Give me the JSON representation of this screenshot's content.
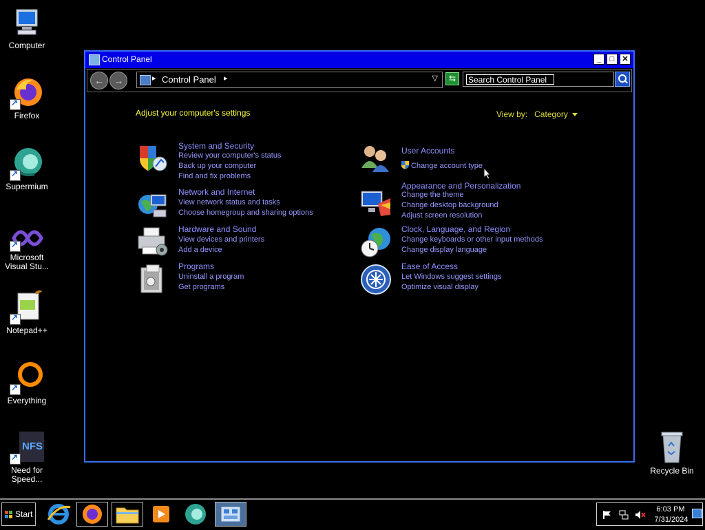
{
  "desktop": {
    "icons": [
      {
        "label": "Computer"
      },
      {
        "label": "Firefox"
      },
      {
        "label": "Supermium"
      },
      {
        "label": "Microsoft Visual Stu..."
      },
      {
        "label": "Notepad++"
      },
      {
        "label": "Everything"
      },
      {
        "label": "Need for Speed..."
      },
      {
        "label": "Recycle Bin"
      }
    ]
  },
  "window": {
    "title": "Control Panel",
    "address": {
      "location": "Control Panel"
    },
    "search": {
      "placeholder": "Search Control Panel"
    },
    "heading": "Adjust your computer's settings",
    "view_by": {
      "label": "View by:",
      "value": "Category"
    },
    "categories": [
      {
        "title": "System and Security",
        "links": [
          "Review your computer's status",
          "Back up your computer",
          "Find and fix problems"
        ]
      },
      {
        "title": "Network and Internet",
        "links": [
          "View network status and tasks",
          "Choose homegroup and sharing options"
        ]
      },
      {
        "title": "Hardware and Sound",
        "links": [
          "View devices and printers",
          "Add a device"
        ]
      },
      {
        "title": "Programs",
        "links": [
          "Uninstall a program",
          "Get programs"
        ]
      },
      {
        "title": "User Accounts",
        "links": [
          "Change account type"
        ]
      },
      {
        "title": "Appearance and Personalization",
        "links": [
          "Change the theme",
          "Change desktop background",
          "Adjust screen resolution"
        ]
      },
      {
        "title": "Clock, Language, and Region",
        "links": [
          "Change keyboards or other input methods",
          "Change display language"
        ]
      },
      {
        "title": "Ease of Access",
        "links": [
          "Let Windows suggest settings",
          "Optimize visual display"
        ]
      }
    ]
  },
  "taskbar": {
    "start_label": "Start",
    "clock": {
      "time": "6:03 PM",
      "date": "7/31/2024"
    }
  },
  "colors": {
    "title_bar": "#0000e8",
    "window_border": "#3a6df0",
    "link": "#9898ff",
    "heading": "#ffff40"
  }
}
